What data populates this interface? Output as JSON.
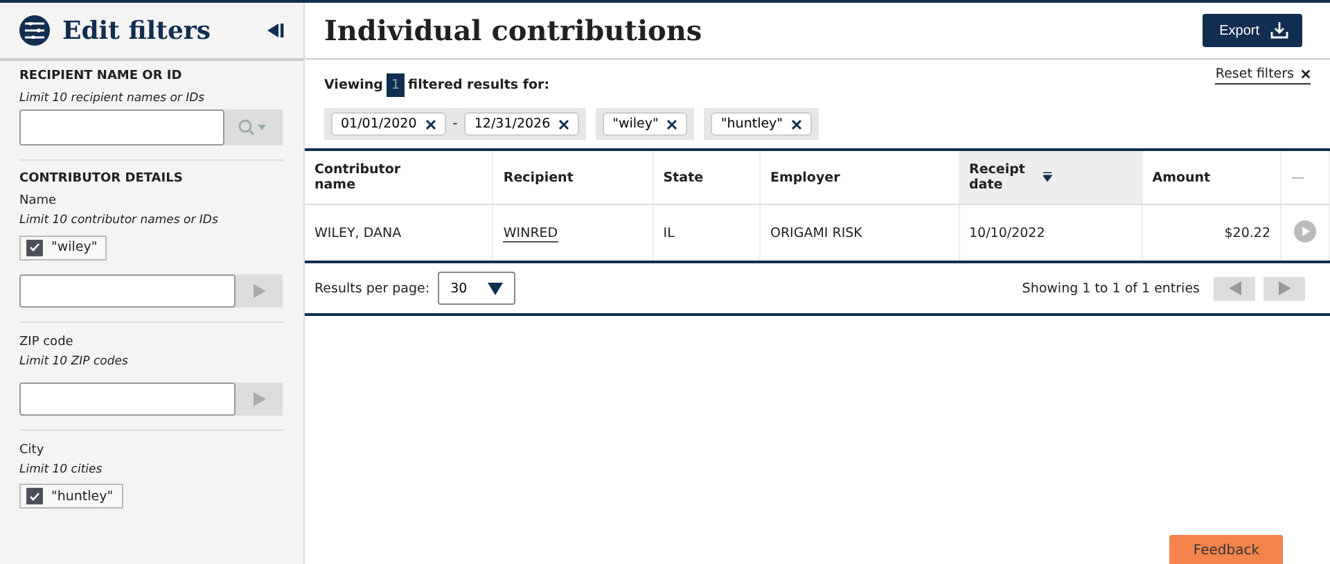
{
  "sidebar": {
    "title": "Edit filters",
    "sections": [
      {
        "heading": "RECIPIENT NAME OR ID",
        "groups": [
          {
            "hint": "Limit 10 recipient names or IDs",
            "input": {
              "kind": "search"
            }
          }
        ]
      },
      {
        "heading": "CONTRIBUTOR DETAILS",
        "groups": [
          {
            "label": "Name",
            "hint": "Limit 10 contributor names or IDs",
            "chips": [
              {
                "label": "\"wiley\"",
                "checked": true
              }
            ],
            "input": {
              "kind": "go"
            }
          },
          {
            "label": "ZIP code",
            "hint": "Limit 10 ZIP codes",
            "input": {
              "kind": "go"
            }
          },
          {
            "label": "City",
            "hint": "Limit 10 cities",
            "chips": [
              {
                "label": "\"huntley\"",
                "checked": true
              }
            ]
          }
        ]
      }
    ]
  },
  "main": {
    "title": "Individual contributions",
    "export_button": "Export",
    "viewing": {
      "before": "Viewing",
      "count": "1",
      "after": "filtered results for:"
    },
    "reset_filters": "Reset filters",
    "filter_groups": [
      {
        "tags": [
          "01/01/2020",
          "12/31/2026"
        ],
        "separator": "-"
      },
      {
        "tags": [
          "\"wiley\""
        ]
      },
      {
        "tags": [
          "\"huntley\""
        ]
      }
    ],
    "table": {
      "columns": [
        {
          "label": "Contributor name",
          "kind": "text",
          "sorted": false
        },
        {
          "label": "Recipient",
          "kind": "link",
          "sorted": false
        },
        {
          "label": "State",
          "kind": "text",
          "sorted": false
        },
        {
          "label": "Employer",
          "kind": "text",
          "sorted": false
        },
        {
          "label": "Receipt date",
          "kind": "text",
          "sorted": true
        },
        {
          "label": "Amount",
          "kind": "money",
          "sorted": false
        },
        {
          "label": "—",
          "kind": "action",
          "sorted": false
        }
      ],
      "rows": [
        [
          "WILEY, DANA",
          "WINRED",
          "IL",
          "ORIGAMI RISK",
          "10/10/2022",
          "$20.22"
        ]
      ]
    },
    "results_per_page": {
      "label": "Results per page:",
      "value": "30"
    },
    "showing": "Showing 1 to 1 of 1 entries",
    "feedback_button": "Feedback"
  }
}
